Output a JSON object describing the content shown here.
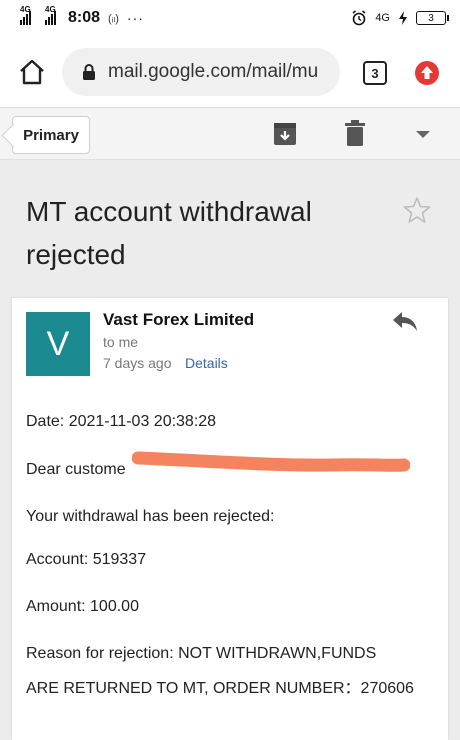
{
  "status_bar": {
    "signal1_tag": "4G",
    "signal2_tag": "4G",
    "time": "8:08",
    "extra": "(ᵢₗ)",
    "dots": "···",
    "net": "4G",
    "battery": "3"
  },
  "browser": {
    "url": "mail.google.com/mail/mu",
    "tab_count": "3"
  },
  "toolbar": {
    "primary_label": "Primary"
  },
  "email": {
    "subject": "MT account withdrawal rejected",
    "sender": "Vast Forex Limited",
    "avatar_letter": "V",
    "to": "to me",
    "ago": "7 days ago",
    "details_label": "Details",
    "body": {
      "date": "Date: 2021-11-03 20:38:28",
      "greeting": "Dear custome",
      "rejected": "Your withdrawal has been rejected:",
      "account": "Account: 519337",
      "amount": "Amount: 100.00",
      "reason_1": "Reason for rejection: NOT WITHDRAWN,FUNDS",
      "reason_2": "ARE RETURNED TO MT, ORDER NUMBER：270606"
    }
  },
  "colors": {
    "avatar_bg": "#1a8a90",
    "update_icon": "#e53935",
    "redaction": "#f4845f",
    "link": "#3366aa"
  }
}
